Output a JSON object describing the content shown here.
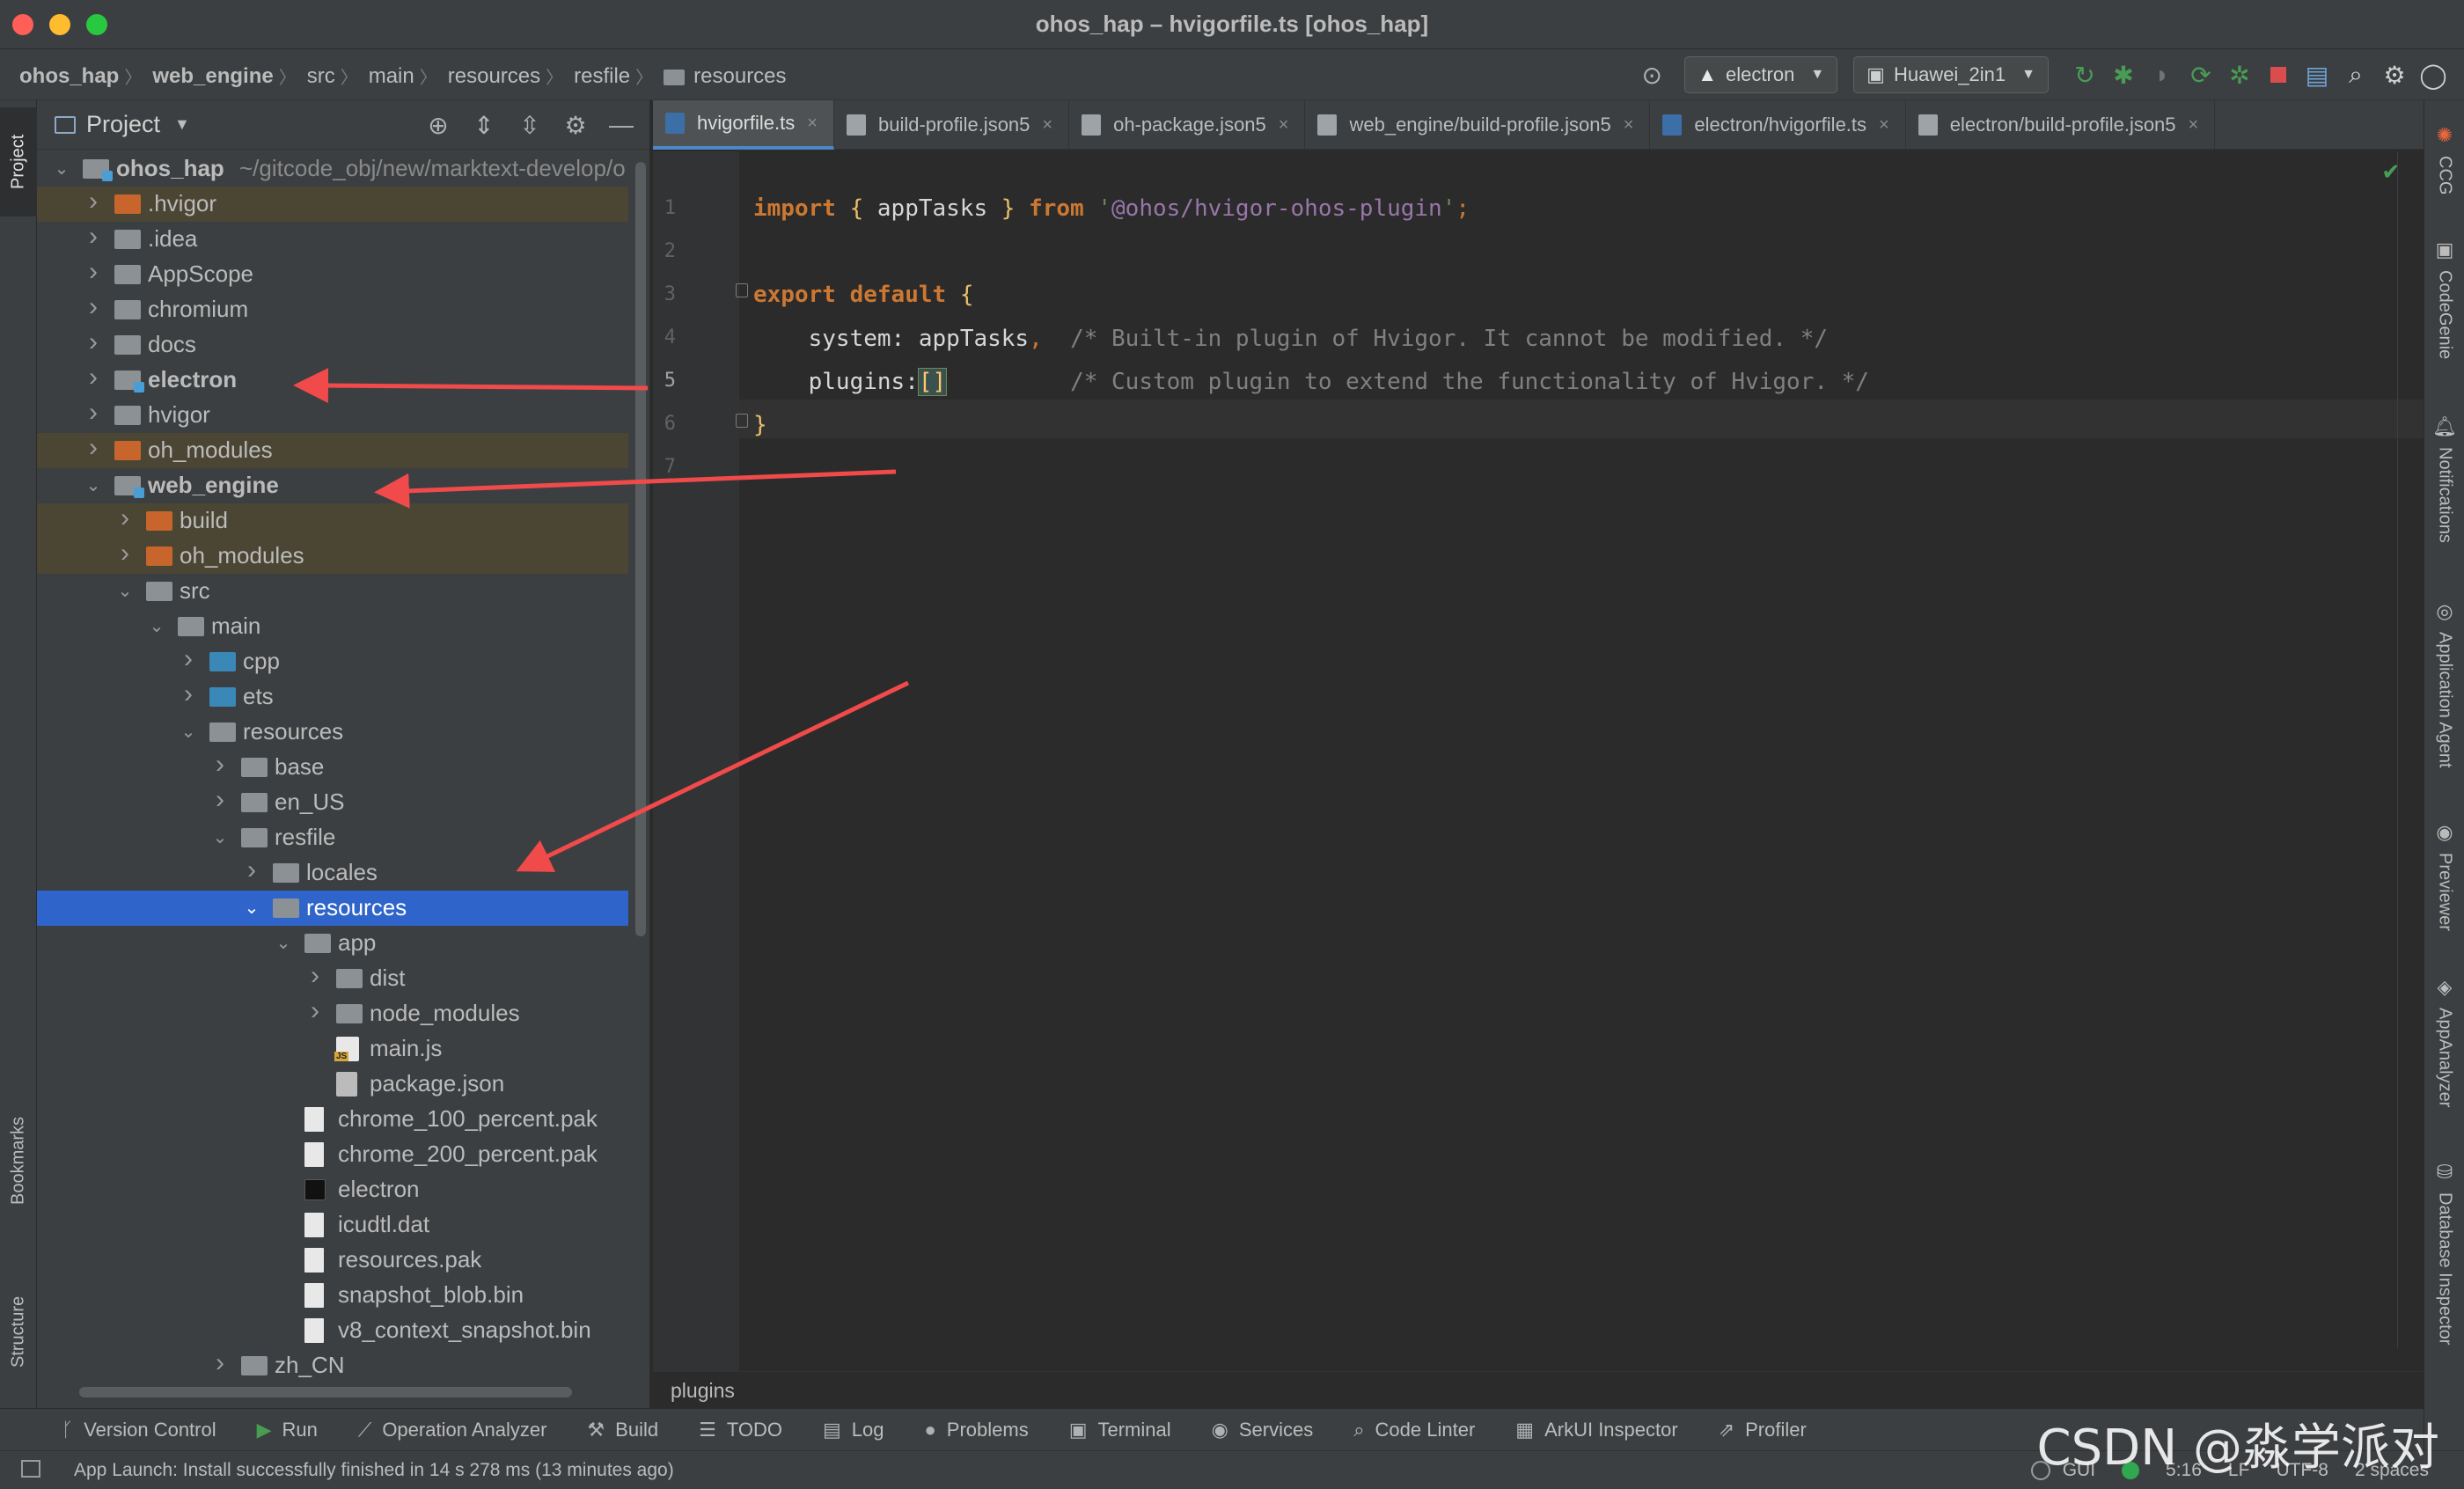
{
  "window": {
    "title": "ohos_hap – hvigorfile.ts [ohos_hap]"
  },
  "breadcrumb": [
    "ohos_hap",
    "web_engine",
    "src",
    "main",
    "resources",
    "resfile",
    "resources"
  ],
  "toolbar": {
    "run_config": "electron",
    "device": "Huawei_2in1"
  },
  "left_strip": {
    "project": "Project",
    "bookmarks": "Bookmarks",
    "structure": "Structure"
  },
  "project_panel": {
    "title": "Project",
    "root_path": "~/gitcode_obj/new/marktext-develop/o",
    "tree": [
      {
        "label": "ohos_hap",
        "depth": 0,
        "arrow": "down",
        "icon": "module-folder",
        "bold": true
      },
      {
        "label": ".hvigor",
        "depth": 1,
        "arrow": "right",
        "icon": "excluded-folder",
        "excluded": true
      },
      {
        "label": ".idea",
        "depth": 1,
        "arrow": "right",
        "icon": "folder"
      },
      {
        "label": "AppScope",
        "depth": 1,
        "arrow": "right",
        "icon": "folder"
      },
      {
        "label": "chromium",
        "depth": 1,
        "arrow": "right",
        "icon": "folder"
      },
      {
        "label": "docs",
        "depth": 1,
        "arrow": "right",
        "icon": "folder"
      },
      {
        "label": "electron",
        "depth": 1,
        "arrow": "right",
        "icon": "module-folder",
        "bold": true
      },
      {
        "label": "hvigor",
        "depth": 1,
        "arrow": "right",
        "icon": "folder"
      },
      {
        "label": "oh_modules",
        "depth": 1,
        "arrow": "right",
        "icon": "excluded-folder",
        "excluded": true
      },
      {
        "label": "web_engine",
        "depth": 1,
        "arrow": "down",
        "icon": "module-folder",
        "bold": true
      },
      {
        "label": "build",
        "depth": 2,
        "arrow": "right",
        "icon": "excluded-folder",
        "excluded": true
      },
      {
        "label": "oh_modules",
        "depth": 2,
        "arrow": "right",
        "icon": "excluded-folder",
        "excluded": true
      },
      {
        "label": "src",
        "depth": 2,
        "arrow": "down",
        "icon": "folder"
      },
      {
        "label": "main",
        "depth": 3,
        "arrow": "down",
        "icon": "folder"
      },
      {
        "label": "cpp",
        "depth": 4,
        "arrow": "right",
        "icon": "source-folder"
      },
      {
        "label": "ets",
        "depth": 4,
        "arrow": "right",
        "icon": "source-folder"
      },
      {
        "label": "resources",
        "depth": 4,
        "arrow": "down",
        "icon": "folder"
      },
      {
        "label": "base",
        "depth": 5,
        "arrow": "right",
        "icon": "folder"
      },
      {
        "label": "en_US",
        "depth": 5,
        "arrow": "right",
        "icon": "folder"
      },
      {
        "label": "resfile",
        "depth": 5,
        "arrow": "down",
        "icon": "folder"
      },
      {
        "label": "locales",
        "depth": 6,
        "arrow": "right",
        "icon": "folder"
      },
      {
        "label": "resources",
        "depth": 6,
        "arrow": "down",
        "icon": "folder",
        "selected": true
      },
      {
        "label": "app",
        "depth": 7,
        "arrow": "down",
        "icon": "folder"
      },
      {
        "label": "dist",
        "depth": 8,
        "arrow": "right",
        "icon": "folder"
      },
      {
        "label": "node_modules",
        "depth": 8,
        "arrow": "right",
        "icon": "folder"
      },
      {
        "label": "main.js",
        "depth": 8,
        "arrow": "",
        "icon": "js-file"
      },
      {
        "label": "package.json",
        "depth": 8,
        "arrow": "",
        "icon": "json-file"
      },
      {
        "label": "chrome_100_percent.pak",
        "depth": 7,
        "arrow": "",
        "icon": "file"
      },
      {
        "label": "chrome_200_percent.pak",
        "depth": 7,
        "arrow": "",
        "icon": "file"
      },
      {
        "label": "electron",
        "depth": 7,
        "arrow": "",
        "icon": "exec-file"
      },
      {
        "label": "icudtl.dat",
        "depth": 7,
        "arrow": "",
        "icon": "file"
      },
      {
        "label": "resources.pak",
        "depth": 7,
        "arrow": "",
        "icon": "file"
      },
      {
        "label": "snapshot_blob.bin",
        "depth": 7,
        "arrow": "",
        "icon": "file"
      },
      {
        "label": "v8_context_snapshot.bin",
        "depth": 7,
        "arrow": "",
        "icon": "file"
      },
      {
        "label": "zh_CN",
        "depth": 5,
        "arrow": "right",
        "icon": "folder"
      }
    ]
  },
  "editor": {
    "tabs": [
      {
        "label": "hvigorfile.ts",
        "icon": "ts",
        "active": true
      },
      {
        "label": "build-profile.json5",
        "icon": "json"
      },
      {
        "label": "oh-package.json5",
        "icon": "json"
      },
      {
        "label": "web_engine/build-profile.json5",
        "icon": "json"
      },
      {
        "label": "electron/hvigorfile.ts",
        "icon": "ts"
      },
      {
        "label": "electron/build-profile.json5",
        "icon": "json"
      }
    ],
    "line_numbers": [
      "1",
      "2",
      "3",
      "4",
      "5",
      "6",
      "7"
    ],
    "current_line": "5",
    "code": {
      "l1": {
        "kw1": "import",
        "b1": "{",
        "id": "appTasks",
        "b2": "}",
        "kw2": "from",
        "str": "'@ohos/hvigor-ohos-plugin'",
        "semi": ";"
      },
      "l3": {
        "kw1": "export",
        "kw2": "default",
        "b": "{"
      },
      "l4": {
        "key": "system",
        "val": "appTasks",
        "comma": ",",
        "comment": "/* Built-in plugin of Hvigor. It cannot be modified. */"
      },
      "l5": {
        "key": "plugins",
        "val": "[]",
        "comment": "/* Custom plugin to extend the functionality of Hvigor. */"
      },
      "l6": {
        "b": "}"
      }
    },
    "breadcrumb": "plugins"
  },
  "right_strip": [
    "CCG",
    "CodeGenie",
    "Notifications",
    "Application Agent",
    "Previewer",
    "AppAnalyzer",
    "Database Inspector"
  ],
  "tool_windows": [
    {
      "label": "Version Control",
      "icon": "branch-icon"
    },
    {
      "label": "Run",
      "icon": "play-icon"
    },
    {
      "label": "Operation Analyzer",
      "icon": "chart-icon"
    },
    {
      "label": "Build",
      "icon": "hammer-icon"
    },
    {
      "label": "TODO",
      "icon": "list-icon"
    },
    {
      "label": "Log",
      "icon": "log-icon"
    },
    {
      "label": "Problems",
      "icon": "warning-icon"
    },
    {
      "label": "Terminal",
      "icon": "terminal-icon"
    },
    {
      "label": "Services",
      "icon": "services-icon"
    },
    {
      "label": "Code Linter",
      "icon": "linter-icon"
    },
    {
      "label": "ArkUI Inspector",
      "icon": "inspector-icon"
    },
    {
      "label": "Profiler",
      "icon": "profiler-icon"
    }
  ],
  "status_bar": {
    "message": "App Launch: Install successfully finished in 14 s 278 ms (13 minutes ago)",
    "gui": "GUI",
    "position": "5:16",
    "line_sep": "LF",
    "encoding": "UTF-8",
    "indent": "2 spaces"
  },
  "watermark": "CSDN @淼学派对",
  "colors": {
    "accent": "#2f65ca",
    "arrow": "#f04a4a",
    "excluded": "#c7652c"
  }
}
